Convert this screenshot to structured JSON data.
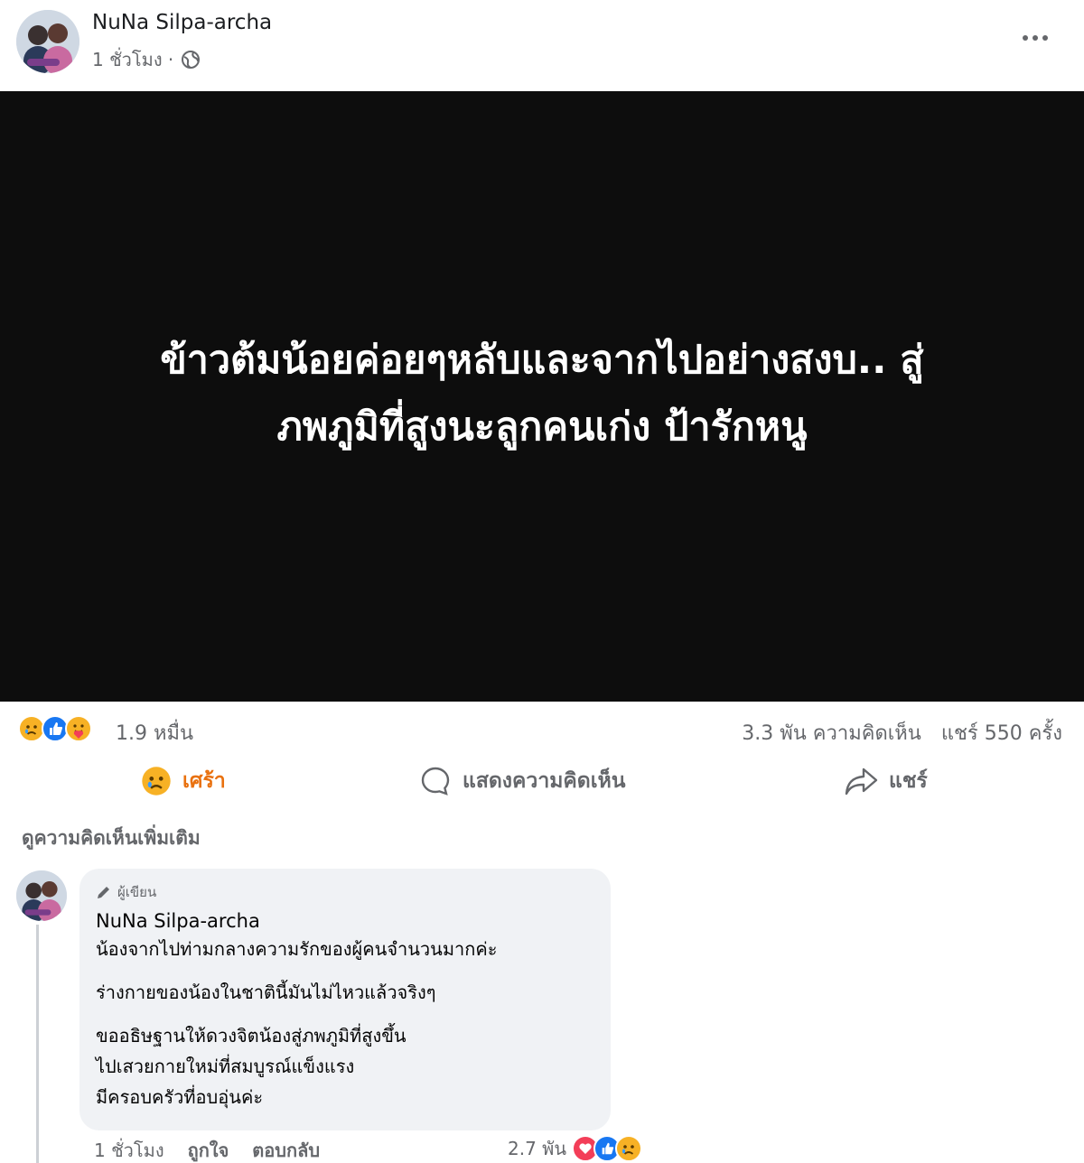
{
  "post": {
    "author": "NuNa Silpa-archa",
    "time": "1 ชั่วโมง ·",
    "image_text_line1": "ข้าวต้มน้อยค่อยๆหลับและจากไปอย่างสงบ.. สู่",
    "image_text_line2": "ภพภูมิที่สูงนะลูกคนเก่ง ป้ารักหนู"
  },
  "summary": {
    "reaction_count": "1.9 หมื่น",
    "comments": "3.3 พัน ความคิดเห็น",
    "shares": "แชร์ 550 ครั้ง"
  },
  "actions": {
    "react_label": "เศร้า",
    "comment_label": "แสดงความคิดเห็น",
    "share_label": "แชร์"
  },
  "more_comments": "ดูความคิดเห็นเพิ่มเติม",
  "comment": {
    "badge": "ผู้เขียน",
    "author": "NuNa Silpa-archa",
    "line1": "น้องจากไปท่ามกลางความรักของผู้คนจำนวนมากค่ะ",
    "line2": "ร่างกายของน้องในชาตินี้มันไม่ไหวแล้วจริงๆ",
    "line3": "ขออธิษฐานให้ดวงจิตน้องสู่ภพภูมิที่สูงขึ้น",
    "line4": "ไปเสวยกายใหม่ที่สมบูรณ์แข็งแรง",
    "line5": "มีครอบครัวที่อบอุ่นค่ะ",
    "time": "1 ชั่วโมง",
    "like": "ถูกใจ",
    "reply": "ตอบกลับ",
    "reaction_count": "2.7 พัน"
  },
  "colors": {
    "image_bg": "#0d0d0d",
    "sad": "#f7b125",
    "like": "#1877f2",
    "love": "#f33e58",
    "meta": "#65676b"
  }
}
